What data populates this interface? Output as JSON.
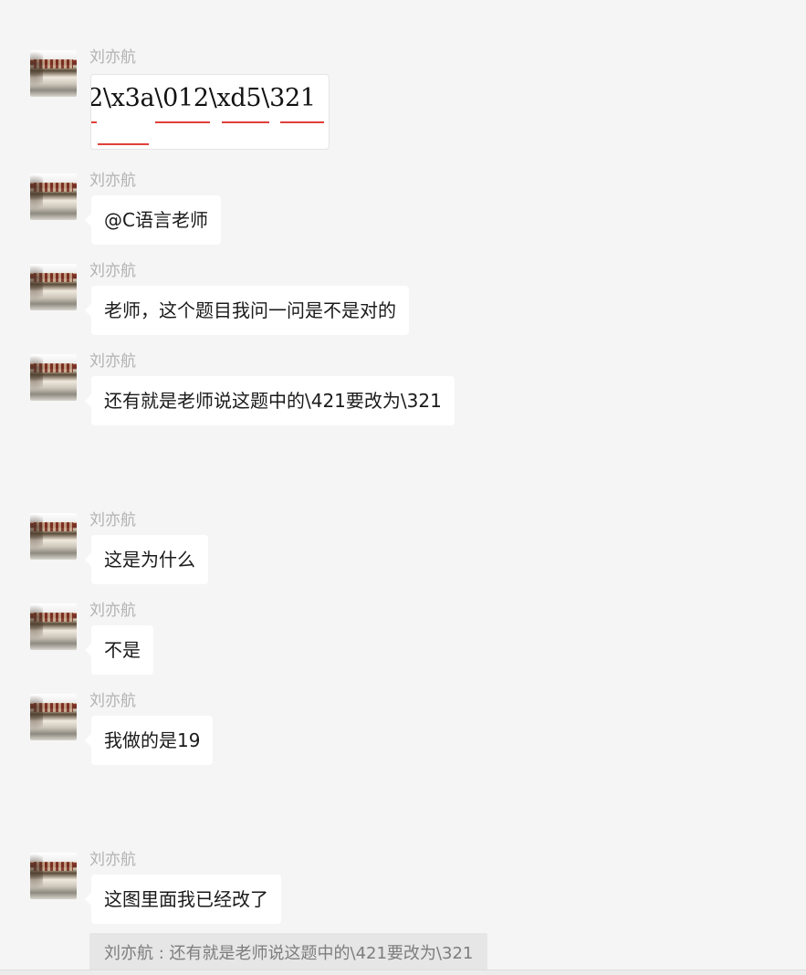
{
  "sender_name": "刘亦航",
  "messages": [
    {
      "type": "image",
      "image_text": "2\\x3a\\012\\xd5\\321"
    },
    {
      "type": "text",
      "text": "@C语言老师"
    },
    {
      "type": "text",
      "text": "老师，这个题目我问一问是不是对的"
    },
    {
      "type": "text",
      "text": "还有就是老师说这题中的\\421要改为\\321"
    },
    {
      "type": "text",
      "text": "这是为什么"
    },
    {
      "type": "text",
      "text": "不是"
    },
    {
      "type": "text",
      "text": "我做的是19"
    },
    {
      "type": "text",
      "text": "这图里面我已经改了"
    }
  ],
  "quote": {
    "text": "刘亦航 : 还有就是老师说这题中的\\421要改为\\321"
  }
}
